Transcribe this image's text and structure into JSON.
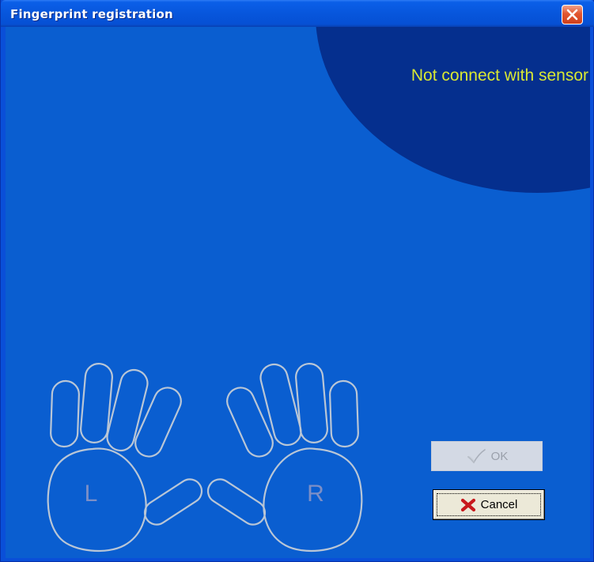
{
  "window": {
    "title": "Fingerprint registration"
  },
  "status": {
    "text": "Not connect with sensor",
    "color": "#d9e833"
  },
  "hands": {
    "left_label": "L",
    "right_label": "R"
  },
  "buttons": {
    "ok_label": "OK",
    "ok_enabled": false,
    "cancel_label": "Cancel"
  },
  "colors": {
    "background": "#0a5ed0",
    "status_area": "#052f8e",
    "hand_outline": "#b9c6d6"
  }
}
